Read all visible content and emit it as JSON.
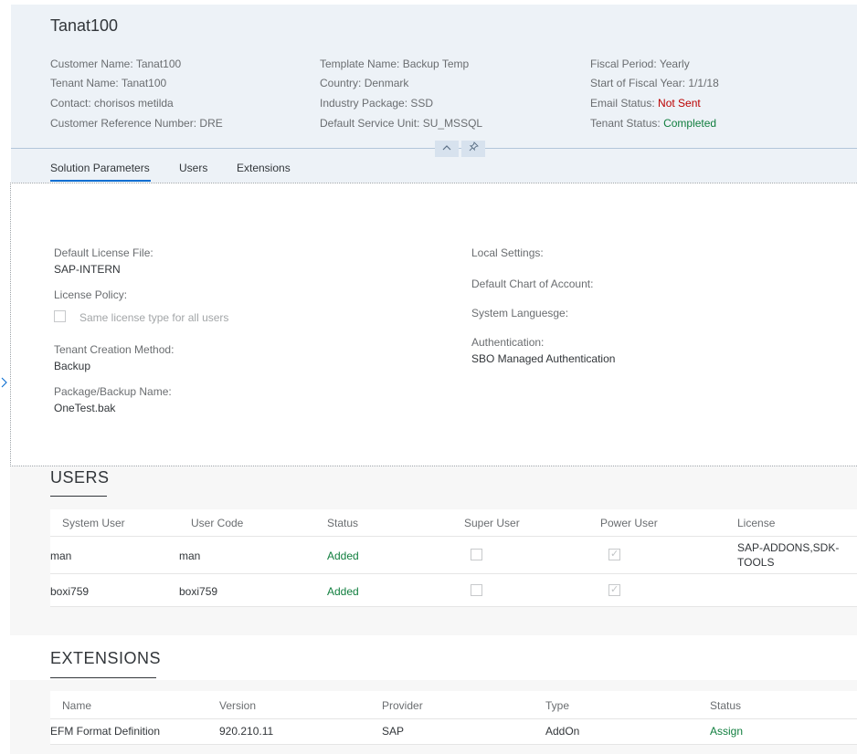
{
  "header": {
    "title": "Tanat100",
    "col1": [
      {
        "label": "Customer Name: ",
        "value": "Tanat100"
      },
      {
        "label": "Tenant Name: ",
        "value": "Tanat100"
      },
      {
        "label": "Contact: ",
        "value": "chorisos metilda"
      },
      {
        "label": "Customer Reference Number: ",
        "value": "DRE"
      }
    ],
    "col2": [
      {
        "label": "Template Name: ",
        "value": "Backup Temp"
      },
      {
        "label": "Country: ",
        "value": "Denmark"
      },
      {
        "label": "Industry Package: ",
        "value": "SSD"
      },
      {
        "label": "Default Service Unit: ",
        "value": "SU_MSSQL"
      }
    ],
    "col3": [
      {
        "label": "Fiscal Period: ",
        "value": "Yearly"
      },
      {
        "label": "Start of Fiscal Year: ",
        "value": "1/1/18"
      },
      {
        "label": "Email Status: ",
        "value": "Not Sent"
      },
      {
        "label": "Tenant Status: ",
        "value": "Completed"
      }
    ],
    "collapse_icon": "chevron-up-icon",
    "pin_icon": "pin-icon",
    "colors": {
      "error": "#bb0000",
      "success": "#107e3e",
      "accent": "#0a6ed1"
    }
  },
  "tabs": [
    {
      "label": "Solution Parameters",
      "selected": true
    },
    {
      "label": "Users",
      "selected": false
    },
    {
      "label": "Extensions",
      "selected": false
    }
  ],
  "solution": {
    "default_license_file_label": "Default License File:",
    "default_license_file_value": "SAP-INTERN",
    "license_policy_label": "License Policy:",
    "same_license_label": "Same license type for all users",
    "same_license_checked": false,
    "tenant_creation_label": "Tenant Creation Method:",
    "tenant_creation_value": "Backup",
    "package_label": "Package/Backup Name:",
    "package_value": "OneTest.bak",
    "local_settings_label": "Local Settings:",
    "chart_of_account_label": "Default Chart of Account:",
    "system_language_label": "System Languesge:",
    "authentication_label": "Authentication:",
    "authentication_value": "SBO Managed Authentication"
  },
  "users": {
    "title": "USERS",
    "columns": [
      "System User",
      "User Code",
      "Status",
      "Super User",
      "Power User",
      "License"
    ],
    "rows": [
      {
        "system_user": "man",
        "user_code": "man",
        "status": "Added",
        "super_user": false,
        "power_user": true,
        "license_line1": "SAP-ADDONS,SDK-",
        "license_line2": "TOOLS"
      },
      {
        "system_user": "boxi759",
        "user_code": "boxi759",
        "status": "Added",
        "super_user": false,
        "power_user": true,
        "license_line1": "",
        "license_line2": ""
      }
    ]
  },
  "extensions": {
    "title": "EXTENSIONS",
    "columns": [
      "Name",
      "Version",
      "Provider",
      "Type",
      "Status"
    ],
    "rows": [
      {
        "name": "EFM Format Definition",
        "version": "920.210.11",
        "provider": "SAP",
        "type": "AddOn",
        "status": "Assign"
      }
    ]
  }
}
